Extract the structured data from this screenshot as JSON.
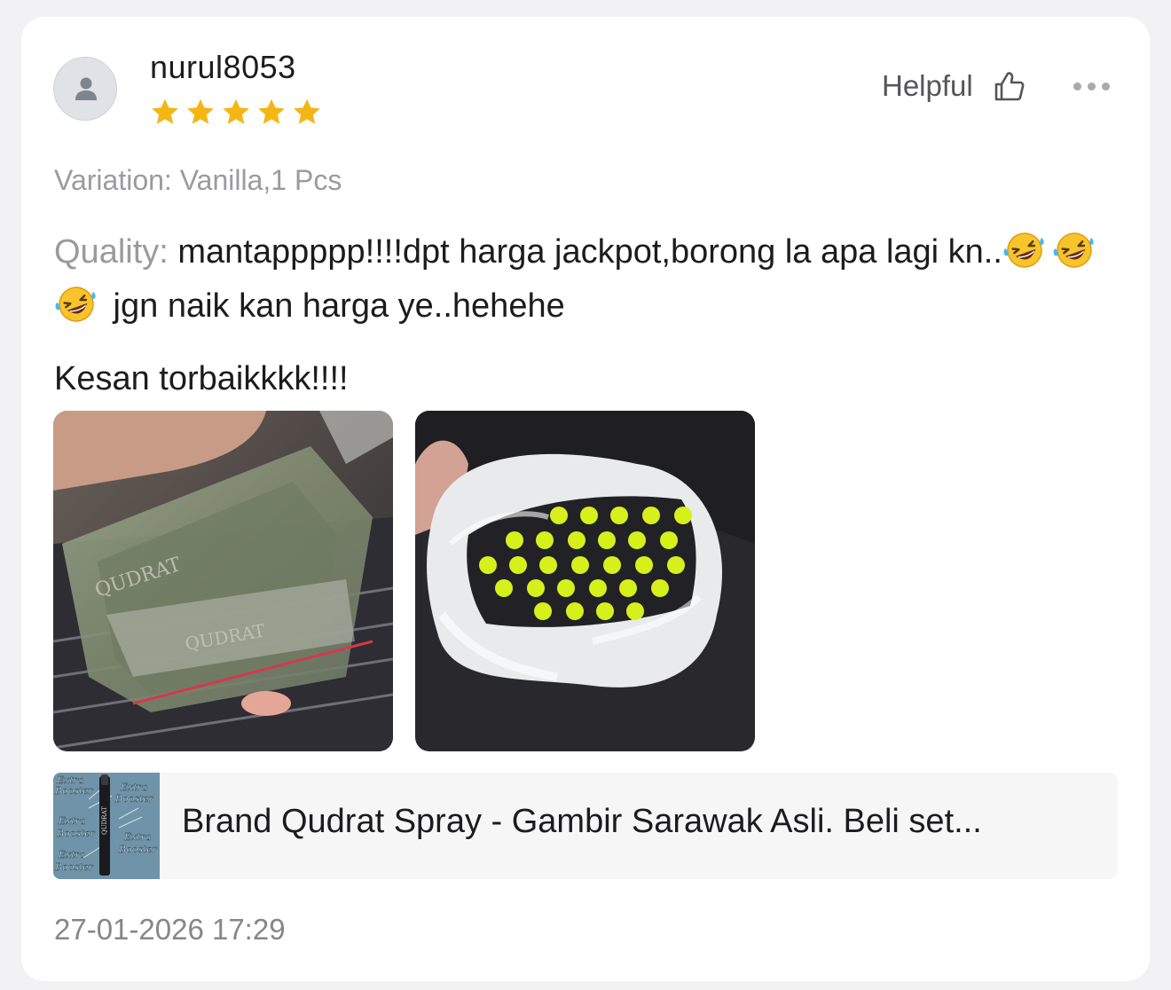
{
  "review": {
    "username": "nurul8053",
    "rating": 5,
    "rating_max": 5,
    "star_color": "#f5b614",
    "helpful_label": "Helpful",
    "variation": "Variation: Vanilla,1 Pcs",
    "quality_label": "Quality:",
    "quality_text_1": " mantappppp!!!!dpt harga jackpot,borong la apa lagi kn..",
    "quality_text_2": " jgn naik kan harga ye..hehehe",
    "emoji_count": 3,
    "emoji_name": "rolling-on-floor-laughing",
    "impression": "Kesan torbaikkkk!!!!",
    "photos": [
      {
        "name": "review-photo-1"
      },
      {
        "name": "review-photo-2"
      }
    ],
    "product": {
      "title": "Brand Qudrat Spray - Gambir Sarawak Asli. Beli set...",
      "thumb_text": "Extra Booster",
      "thumb_brand": "QUDRAT"
    },
    "timestamp": "27-01-2026 17:29"
  }
}
